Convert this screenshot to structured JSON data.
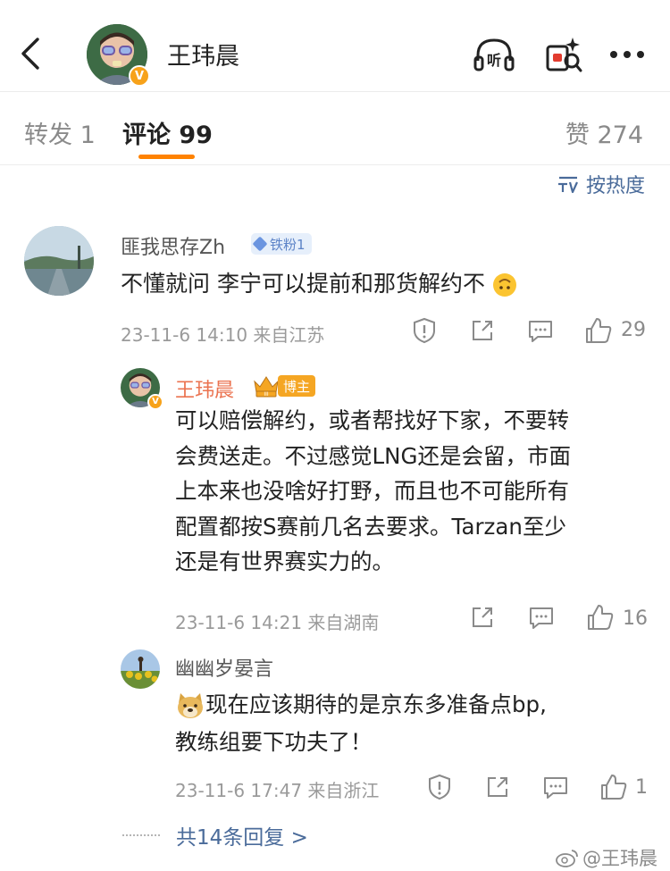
{
  "header": {
    "author_name": "王玮晨",
    "verified_badge": "V",
    "icons": [
      "back-icon",
      "listen-icon",
      "gift-icon",
      "more-icon"
    ],
    "listen_label": "听"
  },
  "tabs": {
    "repost": "转发 1",
    "comment": "评论 99",
    "like": "赞 274"
  },
  "sort": {
    "label": "按热度",
    "icon": "sort-icon"
  },
  "comments": [
    {
      "user": "匪我思存Zh",
      "badge": "铁粉1",
      "text": "不懂就问 李宁可以提前和那货解约不",
      "emoji": "upside-down-face",
      "meta": "23-11-6 14:10 来自江苏",
      "likes": "29"
    }
  ],
  "reply_author": {
    "user": "王玮晨",
    "badge": "博主",
    "badge_level": "III",
    "verified_badge": "V",
    "text_lines": [
      "可以赔偿解约，或者帮找好下家，不要转",
      "会费送走。不过感觉LNG还是会留，市面",
      "上本来也没啥好打野，而且也不可能所有",
      "配置都按S赛前几名去要求。Tarzan至少",
      "还是有世界赛实力的。"
    ],
    "meta": "23-11-6 14:21 来自湖南",
    "likes": "16"
  },
  "reply_user": {
    "user": "幽幽岁晏言",
    "text_lines": [
      "现在应该期待的是京东多准备点bp,",
      "教练组要下功夫了！"
    ],
    "emoji": "doge",
    "meta": "23-11-6 17:47 来自浙江",
    "likes": "1"
  },
  "more_replies": "共14条回复 >",
  "watermark": "@王玮晨",
  "colors": {
    "accent_orange": "#ff8200",
    "link_blue": "#4a6b9a",
    "name_orange": "#eb7350",
    "fan_badge_bg": "#e6effb",
    "verified_gold": "#f7a21a"
  }
}
